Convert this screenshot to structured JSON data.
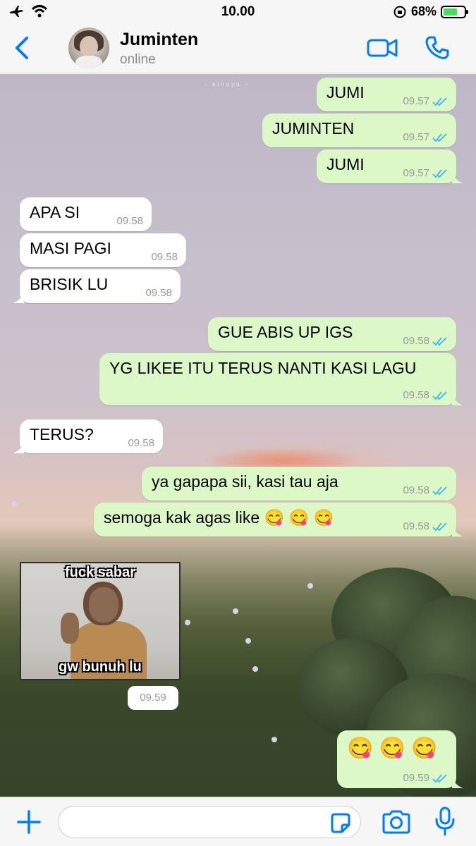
{
  "status_bar": {
    "time": "10.00",
    "battery": "68%",
    "battery_level": 0.68
  },
  "header": {
    "contact_name": "Juminten",
    "contact_status": "online"
  },
  "chat": {
    "watermark": "- ainoyu -",
    "messages": [
      {
        "dir": "out",
        "text": "JUMI",
        "time": "09.57",
        "read": true
      },
      {
        "dir": "out",
        "text": "JUMINTEN",
        "time": "09.57",
        "read": true
      },
      {
        "dir": "out",
        "text": "JUMI",
        "time": "09.57",
        "read": true
      },
      {
        "dir": "in",
        "text": "APA SI",
        "time": "09.58"
      },
      {
        "dir": "in",
        "text": "MASI PAGI",
        "time": "09.58"
      },
      {
        "dir": "in",
        "text": "BRISIK LU",
        "time": "09.58"
      },
      {
        "dir": "out",
        "text": "GUE ABIS UP IGS",
        "time": "09.58",
        "read": true
      },
      {
        "dir": "out",
        "text": "YG LIKEE ITU TERUS NANTI KASI LAGU",
        "time": "09.58",
        "read": true
      },
      {
        "dir": "in",
        "text": "TERUS?",
        "time": "09.58"
      },
      {
        "dir": "out",
        "text": "ya gapapa sii, kasi tau aja",
        "time": "09.58",
        "read": true
      },
      {
        "dir": "out",
        "text": "semoga kak agas like 😋 😋 😋",
        "time": "09.58",
        "read": true
      },
      {
        "dir": "in",
        "type": "sticker",
        "caption_top": "fuck sabar",
        "caption_bottom": "gw bunuh lu",
        "time": "09.59"
      },
      {
        "dir": "out",
        "text": "😋 😋 😋",
        "time": "09.59",
        "read": true
      }
    ]
  },
  "input_bar": {
    "placeholder": ""
  },
  "colors": {
    "accent": "#007aff",
    "outgoing_bubble": "#dcf8c6",
    "incoming_bubble": "#ffffff",
    "read_ticks": "#34b7f1"
  }
}
